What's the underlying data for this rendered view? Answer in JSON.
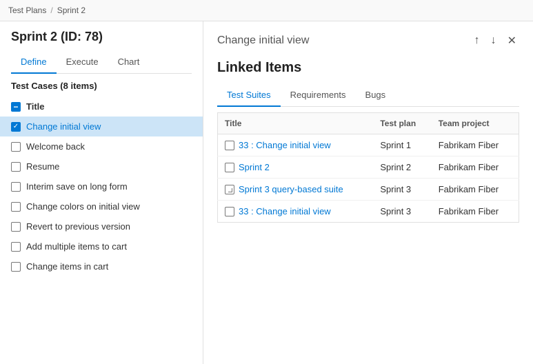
{
  "breadcrumb": {
    "items": [
      "Test Plans",
      "Sprint 2"
    ],
    "separator": "/"
  },
  "left": {
    "sprint_title": "Sprint 2 (ID: 78)",
    "tabs": [
      {
        "label": "Define",
        "active": true
      },
      {
        "label": "Execute",
        "active": false
      },
      {
        "label": "Chart",
        "active": false
      }
    ],
    "test_cases_header": "Test Cases (8 items)",
    "items": [
      {
        "id": "title",
        "label": "Title",
        "type": "header"
      },
      {
        "id": "change-initial-view",
        "label": "Change initial view",
        "type": "checked",
        "active": true
      },
      {
        "id": "welcome-back",
        "label": "Welcome back",
        "type": "unchecked"
      },
      {
        "id": "resume",
        "label": "Resume",
        "type": "unchecked"
      },
      {
        "id": "interim-save",
        "label": "Interim save on long form",
        "type": "unchecked"
      },
      {
        "id": "change-colors",
        "label": "Change colors on initial view",
        "type": "unchecked"
      },
      {
        "id": "revert",
        "label": "Revert to previous version",
        "type": "unchecked"
      },
      {
        "id": "add-multiple",
        "label": "Add multiple items to cart",
        "type": "unchecked"
      },
      {
        "id": "change-items",
        "label": "Change items in cart",
        "type": "unchecked"
      }
    ]
  },
  "right": {
    "panel_title": "Change initial view",
    "linked_items_title": "Linked Items",
    "tabs": [
      {
        "label": "Test Suites",
        "active": true
      },
      {
        "label": "Requirements",
        "active": false
      },
      {
        "label": "Bugs",
        "active": false
      }
    ],
    "table": {
      "columns": [
        "Title",
        "Test plan",
        "Team project"
      ],
      "rows": [
        {
          "icon": "suite",
          "title": "33 : Change initial view",
          "test_plan": "Sprint 1",
          "team_project": "Fabrikam Fiber"
        },
        {
          "icon": "suite",
          "title": "Sprint 2",
          "test_plan": "Sprint 2",
          "team_project": "Fabrikam Fiber"
        },
        {
          "icon": "query-suite",
          "title": "Sprint 3 query-based suite",
          "test_plan": "Sprint 3",
          "team_project": "Fabrikam Fiber"
        },
        {
          "icon": "suite",
          "title": "33 : Change initial view",
          "test_plan": "Sprint 3",
          "team_project": "Fabrikam Fiber"
        }
      ]
    }
  },
  "actions": {
    "up_label": "↑",
    "down_label": "↓",
    "close_label": "✕"
  }
}
